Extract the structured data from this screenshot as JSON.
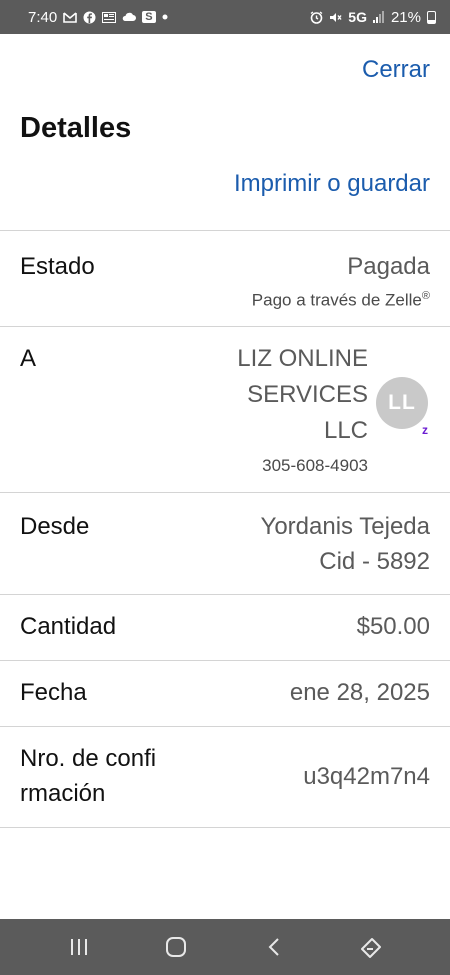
{
  "status_bar": {
    "time": "7:40",
    "network": "5G",
    "battery": "21%",
    "left_icons": [
      "gmail-icon",
      "facebook-icon",
      "news-icon",
      "cloud-icon",
      "s-app-icon",
      "dot-icon"
    ],
    "s_app_label": "S",
    "right_icons": [
      "alarm-icon",
      "mute-icon",
      "signal-icon",
      "battery-icon"
    ]
  },
  "header": {
    "close_label": "Cerrar",
    "title": "Detalles",
    "print_label": "Imprimir o guardar"
  },
  "details": {
    "estado": {
      "label": "Estado",
      "value": "Pagada",
      "sub_value": "Pago a través de Zelle",
      "registered_mark": "®"
    },
    "a": {
      "label": "A",
      "name_lines": [
        "LIZ ONLINE",
        "SERVICES",
        "LLC"
      ],
      "phone": "305-608-4903",
      "avatar_initials": "LL",
      "badge": "z"
    },
    "desde": {
      "label": "Desde",
      "value_lines": [
        "Yordanis Tejeda",
        "Cid - 5892"
      ]
    },
    "cantidad": {
      "label": "Cantidad",
      "value": "$50.00"
    },
    "fecha": {
      "label": "Fecha",
      "value": "ene 28, 2025"
    },
    "confirmacion": {
      "label_lines": [
        "Nro. de confi",
        "rmación"
      ],
      "value": "u3q42m7n4"
    }
  },
  "colors": {
    "link": "#1b5cad",
    "system_bar": "#5b5b5b",
    "zelle": "#6b1cd1"
  },
  "nav_bar": {
    "icons": [
      "recent-apps-icon",
      "home-icon",
      "back-icon",
      "keyboard-switch-icon"
    ]
  }
}
